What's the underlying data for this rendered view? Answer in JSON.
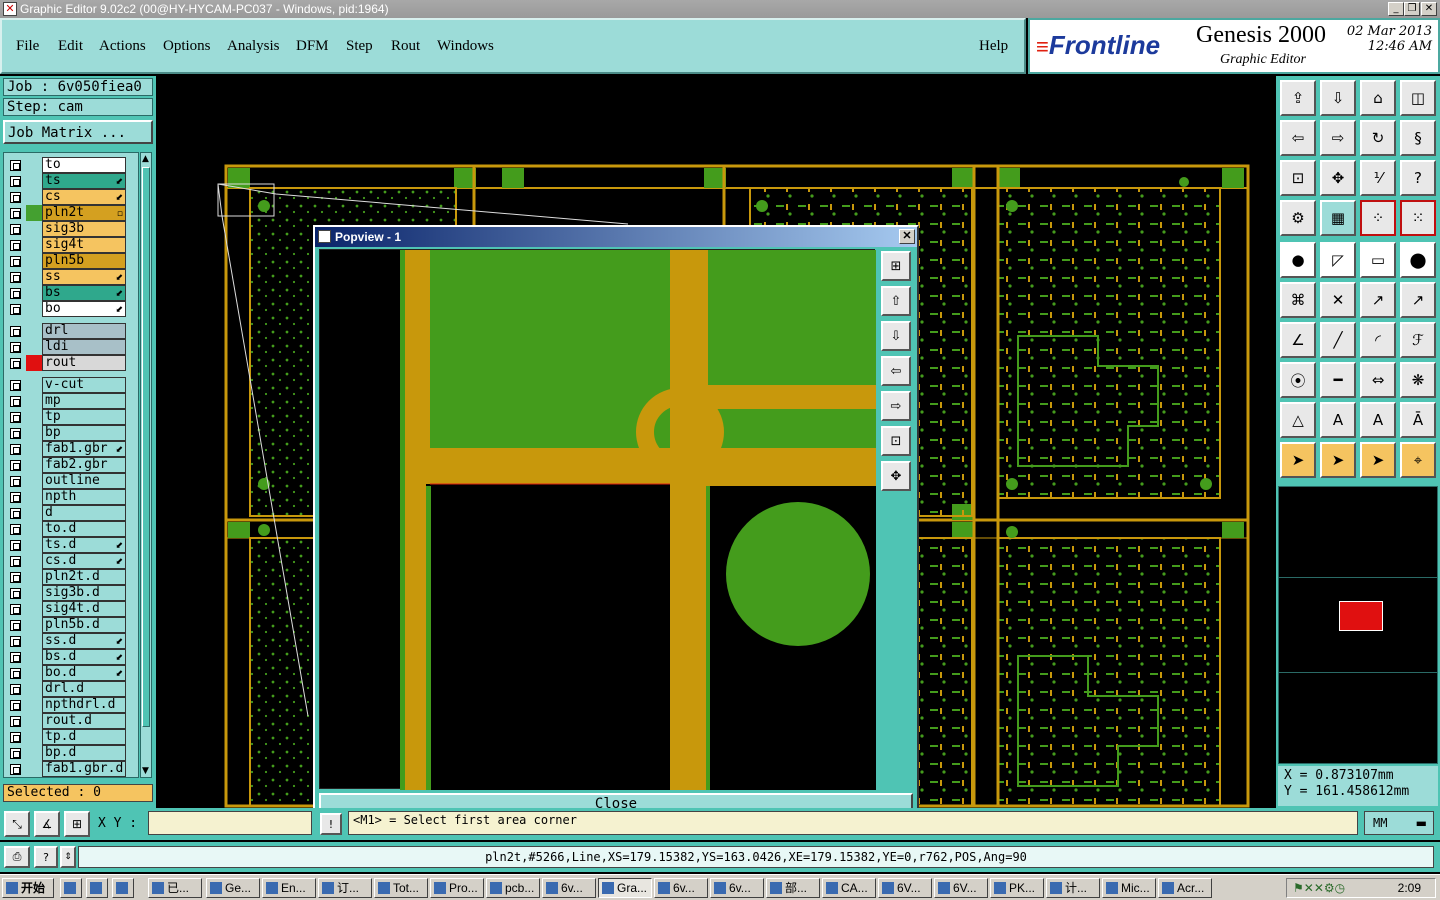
{
  "window": {
    "title": "Graphic Editor 9.02c2 (00@HY-HYCAM-PC037 - Windows, pid:1964)"
  },
  "menu": [
    "File",
    "Edit",
    "Actions",
    "Options",
    "Analysis",
    "DFM",
    "Step",
    "Rout",
    "Windows"
  ],
  "help_label": "Help",
  "brand": {
    "logo": "Frontline",
    "product": "Genesis 2000",
    "subtitle": "Graphic Editor",
    "date": "02 Mar 2013",
    "time": "12:46 AM"
  },
  "job": {
    "job_label": "Job : 6v050fiea0",
    "step_label": "Step: cam",
    "matrix_button": "Job Matrix ..."
  },
  "layers": [
    {
      "name": "to",
      "color": "#ffffff",
      "swatch": ""
    },
    {
      "name": "ts",
      "color": "#2fa88c",
      "swatch": "",
      "arrow": "⬋"
    },
    {
      "name": "cs",
      "color": "#f5c460",
      "swatch": "",
      "arrow": "⬋"
    },
    {
      "name": "pln2t",
      "color": "#d4a020",
      "swatch": "#44a030",
      "arrow": "▫"
    },
    {
      "name": "sig3b",
      "color": "#f5c460",
      "swatch": ""
    },
    {
      "name": "sig4t",
      "color": "#f5c460",
      "swatch": ""
    },
    {
      "name": "pln5b",
      "color": "#d4a020",
      "swatch": ""
    },
    {
      "name": "ss",
      "color": "#f5c460",
      "swatch": "",
      "arrow": "⬋"
    },
    {
      "name": "bs",
      "color": "#2fa88c",
      "swatch": "",
      "arrow": "⬋"
    },
    {
      "name": "bo",
      "color": "#ffffff",
      "swatch": "",
      "arrow": "⬋"
    },
    {
      "name": "drl",
      "color": "#a8c0c8",
      "swatch": ""
    },
    {
      "name": "ldi",
      "color": "#a8c0c8",
      "swatch": ""
    },
    {
      "name": "rout",
      "color": "#d8d8d8",
      "swatch": "#e01010"
    },
    {
      "name": "v-cut",
      "color": "#9cdcd8",
      "swatch": ""
    },
    {
      "name": "mp",
      "color": "#9cdcd8",
      "swatch": ""
    },
    {
      "name": "tp",
      "color": "#9cdcd8",
      "swatch": ""
    },
    {
      "name": "bp",
      "color": "#9cdcd8",
      "swatch": ""
    },
    {
      "name": "fab1.gbr",
      "color": "#9cdcd8",
      "swatch": "",
      "arrow": "⬋"
    },
    {
      "name": "fab2.gbr",
      "color": "#9cdcd8",
      "swatch": ""
    },
    {
      "name": "outline",
      "color": "#9cdcd8",
      "swatch": ""
    },
    {
      "name": "npth",
      "color": "#9cdcd8",
      "swatch": ""
    },
    {
      "name": "d",
      "color": "#9cdcd8",
      "swatch": ""
    },
    {
      "name": "to.d",
      "color": "#9cdcd8",
      "swatch": ""
    },
    {
      "name": "ts.d",
      "color": "#9cdcd8",
      "swatch": "",
      "arrow": "⬋"
    },
    {
      "name": "cs.d",
      "color": "#9cdcd8",
      "swatch": "",
      "arrow": "⬋"
    },
    {
      "name": "pln2t.d",
      "color": "#9cdcd8",
      "swatch": ""
    },
    {
      "name": "sig3b.d",
      "color": "#9cdcd8",
      "swatch": ""
    },
    {
      "name": "sig4t.d",
      "color": "#9cdcd8",
      "swatch": ""
    },
    {
      "name": "pln5b.d",
      "color": "#9cdcd8",
      "swatch": ""
    },
    {
      "name": "ss.d",
      "color": "#9cdcd8",
      "swatch": "",
      "arrow": "⬋"
    },
    {
      "name": "bs.d",
      "color": "#9cdcd8",
      "swatch": "",
      "arrow": "⬋"
    },
    {
      "name": "bo.d",
      "color": "#9cdcd8",
      "swatch": "",
      "arrow": "⬋"
    },
    {
      "name": "drl.d",
      "color": "#9cdcd8",
      "swatch": ""
    },
    {
      "name": "npthdrl.d",
      "color": "#9cdcd8",
      "swatch": ""
    },
    {
      "name": "rout.d",
      "color": "#9cdcd8",
      "swatch": ""
    },
    {
      "name": "tp.d",
      "color": "#9cdcd8",
      "swatch": ""
    },
    {
      "name": "bp.d",
      "color": "#9cdcd8",
      "swatch": ""
    },
    {
      "name": "fab1.gbr.d",
      "color": "#9cdcd8",
      "swatch": ""
    }
  ],
  "selected": "Selected : 0",
  "popview": {
    "title": "Popview - 1",
    "close_label": "Close"
  },
  "coords": {
    "x": "X = 0.873107mm",
    "y": "Y = 161.458612mm"
  },
  "xy_label": "X Y :",
  "message": "<M1> = Select first area corner",
  "units": "MM",
  "status_line": "pln2t,#5266,Line,XS=179.15382,YS=163.0426,XE=179.15382,YE=0,r762,POS,Ang=90",
  "taskbar": {
    "start": "开始",
    "items": [
      "已...",
      "Ge...",
      "En...",
      "订...",
      "Tot...",
      "Pro...",
      "pcb...",
      "6v...",
      "Gra...",
      "6v...",
      "6v...",
      "部...",
      "CA...",
      "6V...",
      "6V...",
      "PK...",
      "计...",
      "Mic...",
      "Acr..."
    ],
    "active_index": 8,
    "clock": "2:09"
  },
  "colors": {
    "panel": "#4fc4b4",
    "light": "#9cdcd8",
    "copper": "#c8980c",
    "pad": "#449c1c"
  }
}
